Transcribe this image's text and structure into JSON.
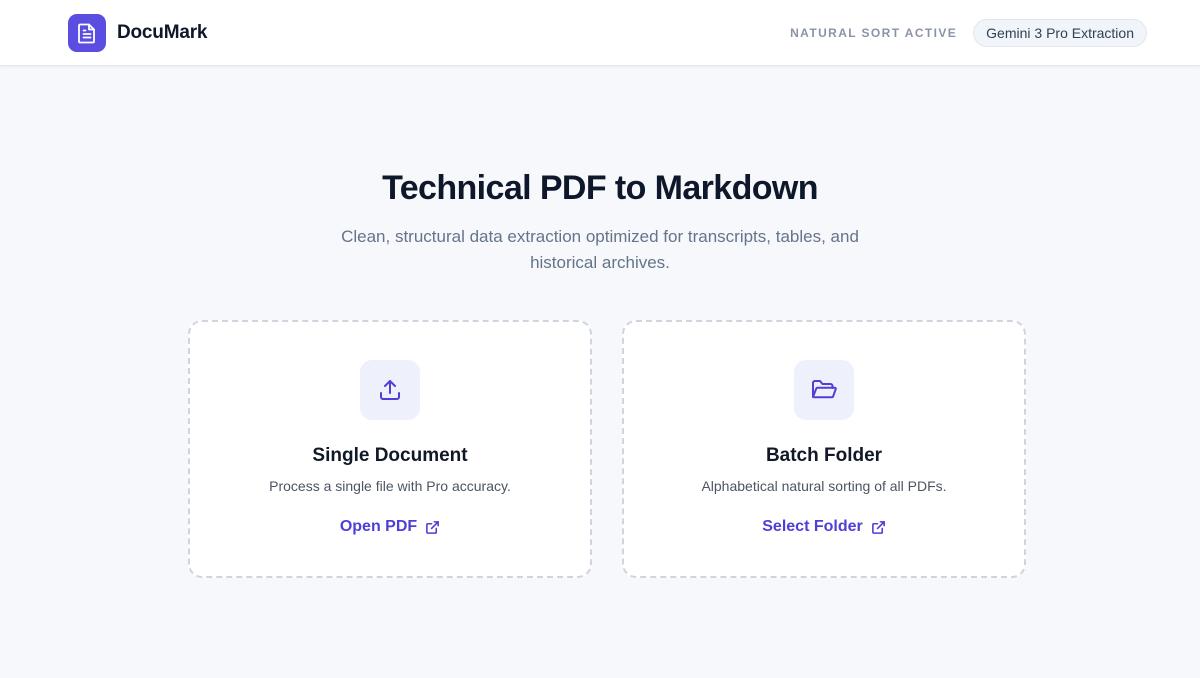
{
  "app": {
    "name": "DocuMark",
    "logo_icon": "document-icon",
    "accent_color": "#5b4de0"
  },
  "header": {
    "sort_status": "NATURAL SORT ACTIVE",
    "model_badge": "Gemini 3 Pro Extraction"
  },
  "hero": {
    "title": "Technical PDF to Markdown",
    "subtitle": "Clean, structural data extraction optimized for transcripts, tables, and historical archives."
  },
  "cards": [
    {
      "icon": "upload-icon",
      "title": "Single Document",
      "description": "Process a single file with Pro accuracy.",
      "action_label": "Open PDF",
      "action_icon": "external-link-icon"
    },
    {
      "icon": "folder-open-icon",
      "title": "Batch Folder",
      "description": "Alphabetical natural sorting of all PDFs.",
      "action_label": "Select Folder",
      "action_icon": "external-link-icon"
    }
  ]
}
